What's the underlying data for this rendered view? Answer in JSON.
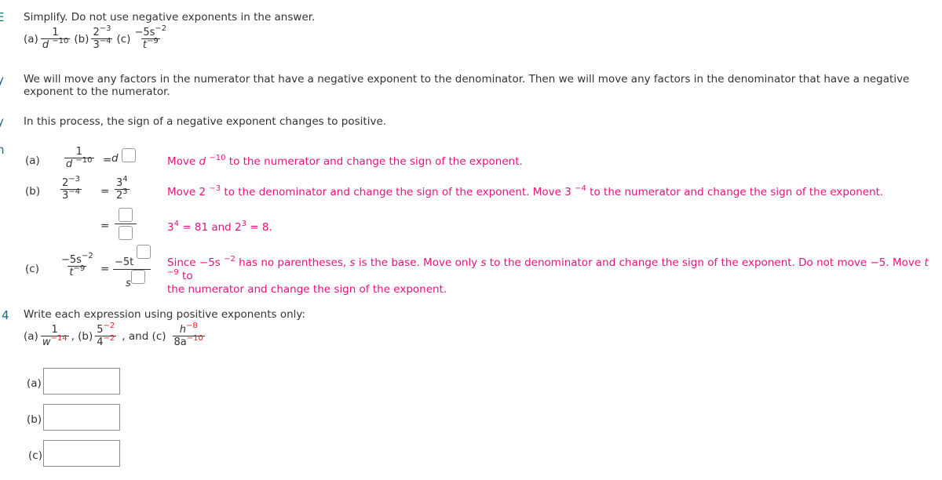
{
  "edge_labels": [
    "E",
    "y",
    "y",
    "n",
    "4"
  ],
  "problem": {
    "instruction": "Simplify. Do not use negative exponents in the answer.",
    "parts": [
      {
        "label": "(a)",
        "num": "1",
        "den_base": "d",
        "den_exp": "−10"
      },
      {
        "label": "(b)",
        "num_base": "2",
        "num_exp": "−3",
        "den_base": "3",
        "den_exp": "−4"
      },
      {
        "label": "(c)",
        "num_base": "−5s",
        "num_exp": "−2",
        "den_base": "t",
        "den_exp": "−9"
      }
    ]
  },
  "steps": {
    "step1": "We will move any factors in the numerator that have a negative exponent to the denominator. Then we will move any factors in the denominator that have a negative exponent to the numerator.",
    "step2": "In this process, the sign of a negative exponent changes to positive."
  },
  "worked": {
    "a": {
      "label": "(a)",
      "num": "1",
      "den_base": "d",
      "den_exp": "−10",
      "eq": "=",
      "result_base": "d",
      "hint_pre": "Move ",
      "hint_var": "d",
      "hint_exp": "−10",
      "hint_post": " to the numerator and change the sign of the exponent."
    },
    "b": {
      "label": "(b)",
      "num_base": "2",
      "num_exp": "−3",
      "den_base": "3",
      "den_exp": "−4",
      "eq": "=",
      "r_num_base": "3",
      "r_num_exp": "4",
      "r_den_base": "2",
      "r_den_exp": "3",
      "hint_pre": "Move 2 ",
      "hint_exp1": "−3",
      "hint_mid": " to the denominator and change the sign of the exponent. Move 3 ",
      "hint_exp2": "−4",
      "hint_post": " to the numerator and change the sign of the exponent.",
      "eq2": "=",
      "calc_a": "3",
      "calc_a_exp": "4",
      "calc_mid": " = 81 and 2",
      "calc_b_exp": "3",
      "calc_end": " = 8."
    },
    "c": {
      "label": "(c)",
      "num_base": "−5s",
      "num_exp": "−2",
      "den_base": "t",
      "den_exp": "−9",
      "eq": "=",
      "r_num": "−5t",
      "r_den": "s",
      "hint_pre": "Since −5s ",
      "hint_exp1": "−2",
      "hint_mid1": " has no parentheses, ",
      "hint_s1": "s",
      "hint_mid2": " is the base. Move only ",
      "hint_s2": "s",
      "hint_mid3": " to the denominator and change the sign of the exponent. Do not move −5. Move ",
      "hint_t": "t",
      "hint_exp2": "−9",
      "hint_post": " to",
      "hint_line2": "the numerator and change the sign of the exponent."
    }
  },
  "exercise": {
    "instruction": "Write each expression using positive exponents only:",
    "a_label": "(a)",
    "a_num": "1",
    "a_den_base": "w",
    "a_den_exp": "−14",
    "sep1": ", (b)",
    "b_num_base": "5",
    "b_num_exp": "−2",
    "b_den_base": "4",
    "b_den_exp": "−2",
    "sep2": ", and (c)",
    "c_num_base": "h",
    "c_num_exp": "−8",
    "c_den_base": "8a",
    "c_den_exp": "−10",
    "answers": [
      {
        "label": "(a)",
        "value": ""
      },
      {
        "label": "(b)",
        "value": ""
      },
      {
        "label": "(c)",
        "value": ""
      }
    ]
  }
}
